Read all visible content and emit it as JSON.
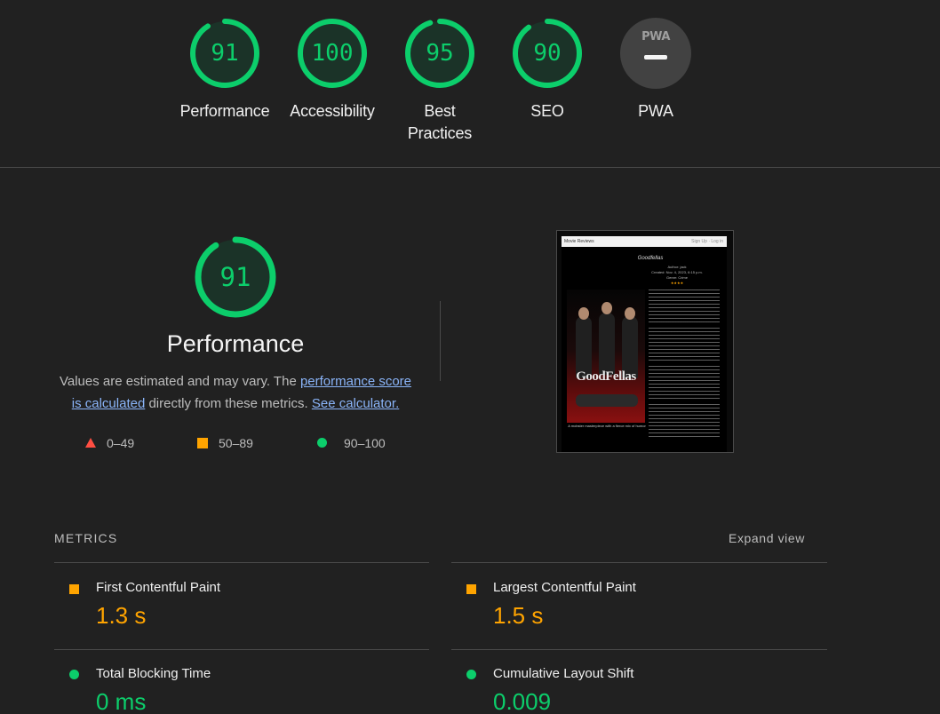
{
  "colors": {
    "pass": "#0cce6b",
    "average": "#ffa400",
    "fail": "#ff4e42",
    "background": "#212121",
    "link": "#8ab4f8"
  },
  "categories": [
    {
      "label": "Performance",
      "score": "91",
      "value": 91
    },
    {
      "label": "Accessibility",
      "score": "100",
      "value": 100
    },
    {
      "label": "Best Practices",
      "score": "95",
      "value": 95
    },
    {
      "label": "SEO",
      "score": "90",
      "value": 90
    },
    {
      "label": "PWA",
      "badge_text": "PWA"
    }
  ],
  "performance": {
    "score": "91",
    "value": 91,
    "title": "Performance",
    "desc_prefix": "Values are estimated and may vary. The ",
    "desc_link1": "performance score is calculated",
    "desc_middle": " directly from these metrics. ",
    "desc_link2": "See calculator."
  },
  "legend": [
    {
      "range": "0–49",
      "icon": "triangle-icon"
    },
    {
      "range": "50–89",
      "icon": "square-icon"
    },
    {
      "range": "90–100",
      "icon": "circle-icon"
    }
  ],
  "screenshot": {
    "nav_brand": "Movie Reviews",
    "nav_links": "Sign Up · Log in",
    "review_title": "Goodfellas",
    "meta_lines": [
      "Author: jack",
      "Created: Nov. 4, 2023, 6:15 p.m.",
      "Genre: Crime"
    ],
    "stars": "★★★★",
    "poster_title": "GoodFellas",
    "caption": "A mobster masterpiece with a fierce mix of humor"
  },
  "metrics_section": {
    "header": "METRICS",
    "expand_label": "Expand view"
  },
  "metrics": [
    {
      "name": "First Contentful Paint",
      "value": "1.3 s",
      "status": "average"
    },
    {
      "name": "Largest Contentful Paint",
      "value": "1.5 s",
      "status": "average"
    },
    {
      "name": "Total Blocking Time",
      "value": "0 ms",
      "status": "pass"
    },
    {
      "name": "Cumulative Layout Shift",
      "value": "0.009",
      "status": "pass"
    }
  ]
}
